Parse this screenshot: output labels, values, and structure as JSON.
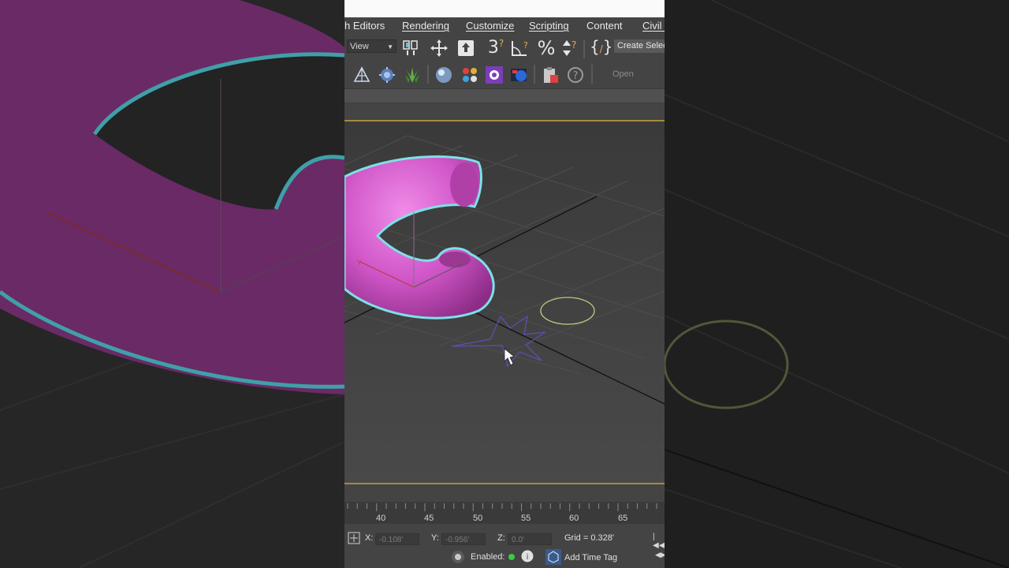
{
  "menu": {
    "items": [
      "h Editors",
      "Rendering",
      "Customize",
      "Scripting",
      "Content",
      "Civil V"
    ]
  },
  "toolbar": {
    "view_select": "View",
    "create_selection": "Create Selec",
    "open_label": "Open",
    "icons": [
      "select-link-icon",
      "move-icon",
      "place-icon",
      "snaps-3-icon",
      "angle-snap-icon",
      "percent-snap-icon",
      "spinner-snap-icon",
      "curly-braces-icon",
      "schematic-icon",
      "material-icon",
      "foliage-icon",
      "sphere-render-icon",
      "material-editor-icon",
      "render-setup-icon",
      "render-frame-icon",
      "clipboard-icon",
      "help-icon"
    ]
  },
  "timeline": {
    "ticks": [
      "40",
      "45",
      "50",
      "55",
      "60",
      "65"
    ]
  },
  "status": {
    "x_label": "X:",
    "x_value": "-0.108'",
    "y_label": "Y:",
    "y_value": "-0.956'",
    "z_label": "Z:",
    "z_value": "0.0'",
    "grid": "Grid = 0.328'",
    "enabled_label": "Enabled:",
    "add_time_tag": "Add Time Tag"
  },
  "colors": {
    "torus": "#d056c8",
    "selection_outline": "#7ee0e8",
    "star_outline": "#5a4fb0",
    "circle_outline": "#c8c880",
    "viewport_border": "#a58c3c"
  }
}
